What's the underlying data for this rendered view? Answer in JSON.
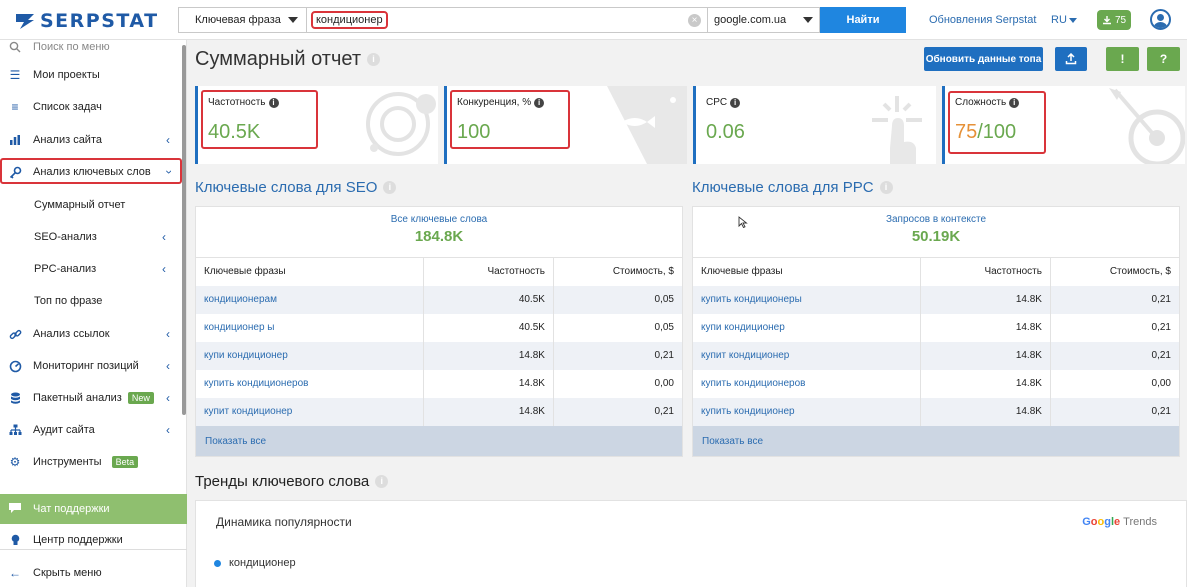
{
  "header": {
    "logo_text": "SERPSTAT",
    "search_type": "Ключевая фраза",
    "query": "кондиционер",
    "database": "google.com.ua",
    "find_label": "Найти",
    "updates_link": "Обновления Serpstat",
    "language": "RU",
    "credits": "75"
  },
  "sidebar": {
    "search_placeholder": "Поиск по меню",
    "items": [
      {
        "label": "Мои проекты",
        "icon": "menu-icon"
      },
      {
        "label": "Список задач",
        "icon": "list-icon"
      },
      {
        "label": "Анализ сайта",
        "icon": "bar-chart-icon"
      },
      {
        "label": "Анализ ключевых слов",
        "icon": "key-icon"
      },
      {
        "label": "Анализ ссылок",
        "icon": "link-icon"
      },
      {
        "label": "Мониторинг позиций",
        "icon": "gauge-icon"
      },
      {
        "label": "Пакетный анализ",
        "icon": "database-icon",
        "badge": "New"
      },
      {
        "label": "Аудит сайта",
        "icon": "sitemap-icon"
      },
      {
        "label": "Инструменты",
        "icon": "gear-icon",
        "badge": "Beta"
      }
    ],
    "subitems": [
      "Суммарный отчет",
      "SEO-анализ",
      "PPC-анализ",
      "Топ по фразе"
    ],
    "support_chat": "Чат поддержки",
    "support_center": "Центр поддержки",
    "hide_menu": "Скрыть меню"
  },
  "main": {
    "title": "Суммарный отчет",
    "refresh_label": "Обновить данные топа",
    "metrics": [
      {
        "label": "Частотность",
        "value": "40.5K"
      },
      {
        "label": "Конкуренция, %",
        "value": "100"
      },
      {
        "label": "CPC",
        "value": "0.06"
      },
      {
        "label": "Сложность",
        "value_main": "75",
        "value_rest": "/100"
      }
    ],
    "seo": {
      "title": "Ключевые слова для SEO",
      "summary_label": "Все ключевые слова",
      "summary_value": "184.8K",
      "columns": [
        "Ключевые фразы",
        "Частотность",
        "Стоимость, $"
      ],
      "rows": [
        [
          "кондиционерам",
          "40.5K",
          "0,05"
        ],
        [
          "кондиционер ы",
          "40.5K",
          "0,05"
        ],
        [
          "купи кондиционер",
          "14.8K",
          "0,21"
        ],
        [
          "купить кондиционеров",
          "14.8K",
          "0,00"
        ],
        [
          "купит кондиционер",
          "14.8K",
          "0,21"
        ]
      ],
      "show_all": "Показать все"
    },
    "ppc": {
      "title": "Ключевые слова для PPC",
      "summary_label": "Запросов в контексте",
      "summary_value": "50.19K",
      "columns": [
        "Ключевые фразы",
        "Частотность",
        "Стоимость, $"
      ],
      "rows": [
        [
          "купить кондиционеры",
          "14.8K",
          "0,21"
        ],
        [
          "купи кондиционер",
          "14.8K",
          "0,21"
        ],
        [
          "купит кондиционер",
          "14.8K",
          "0,21"
        ],
        [
          "купить кондиционеров",
          "14.8K",
          "0,00"
        ],
        [
          "купить кондиционер",
          "14.8K",
          "0,21"
        ]
      ],
      "show_all": "Показать все"
    },
    "trends": {
      "title": "Тренды ключевого слова",
      "subtitle": "Динамика популярности",
      "brand": "Trends",
      "legend": "кондиционер"
    }
  },
  "colors": {
    "brand_blue": "#1f5aa6",
    "accent_blue": "#1f86e0",
    "green": "#6aa84f",
    "orange": "#e69138",
    "highlight_red": "#d9343a"
  }
}
